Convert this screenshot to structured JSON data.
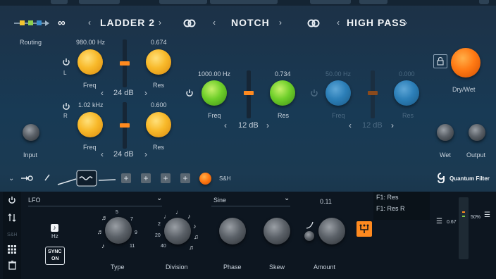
{
  "header": {
    "filter1_name": "LADDER 2",
    "filter2_name": "NOTCH",
    "filter3_name": "HIGH PASS",
    "link_glyph": "∞"
  },
  "routing": {
    "label": "Routing"
  },
  "ladder": {
    "left_channel": "L",
    "right_channel": "R",
    "freq_l_value": "980.00 Hz",
    "res_l_value": "0.674",
    "freq_r_value": "1.02 kHz",
    "res_r_value": "0.600",
    "freq_label": "Freq",
    "res_label": "Res",
    "slope_top": "24 dB",
    "slope_bottom": "24 dB"
  },
  "notch": {
    "freq_value": "1000.00 Hz",
    "res_value": "0.734",
    "freq_label": "Freq",
    "res_label": "Res",
    "slope": "12 dB"
  },
  "highpass": {
    "freq_value": "50.00 Hz",
    "res_value": "0.000",
    "freq_label": "Freq",
    "res_label": "Res",
    "slope": "12 dB"
  },
  "io": {
    "input_label": "Input",
    "drywet_label": "Dry/Wet",
    "wet_label": "Wet",
    "output_label": "Output"
  },
  "modstrip": {
    "sh_label": "S&H",
    "brand": "Quantum Filter"
  },
  "lfo": {
    "source": "LFO",
    "shape": "Sine",
    "amount_value": "0.11",
    "hz_label": "Hz",
    "sync_line1": "SYNC",
    "sync_line2": "ON",
    "sh_small": "S&H",
    "type_label": "Type",
    "division_label": "Division",
    "phase_label": "Phase",
    "skew_label": "Skew",
    "amount_label": "Amount",
    "type_ticks": [
      "5",
      "7",
      "9",
      "11"
    ],
    "division_ticks": [
      "2",
      "20",
      "40"
    ]
  },
  "targets": {
    "items": [
      "F1: Res",
      "F1: Res R"
    ],
    "meter_value": "0.67",
    "meter_pct": "50%"
  },
  "colors": {
    "accent": "#ff8a1f",
    "ladder_knob": "#f8b92a",
    "notch_knob": "#6fcf2a",
    "hp_knob": "#2c7fb8"
  }
}
